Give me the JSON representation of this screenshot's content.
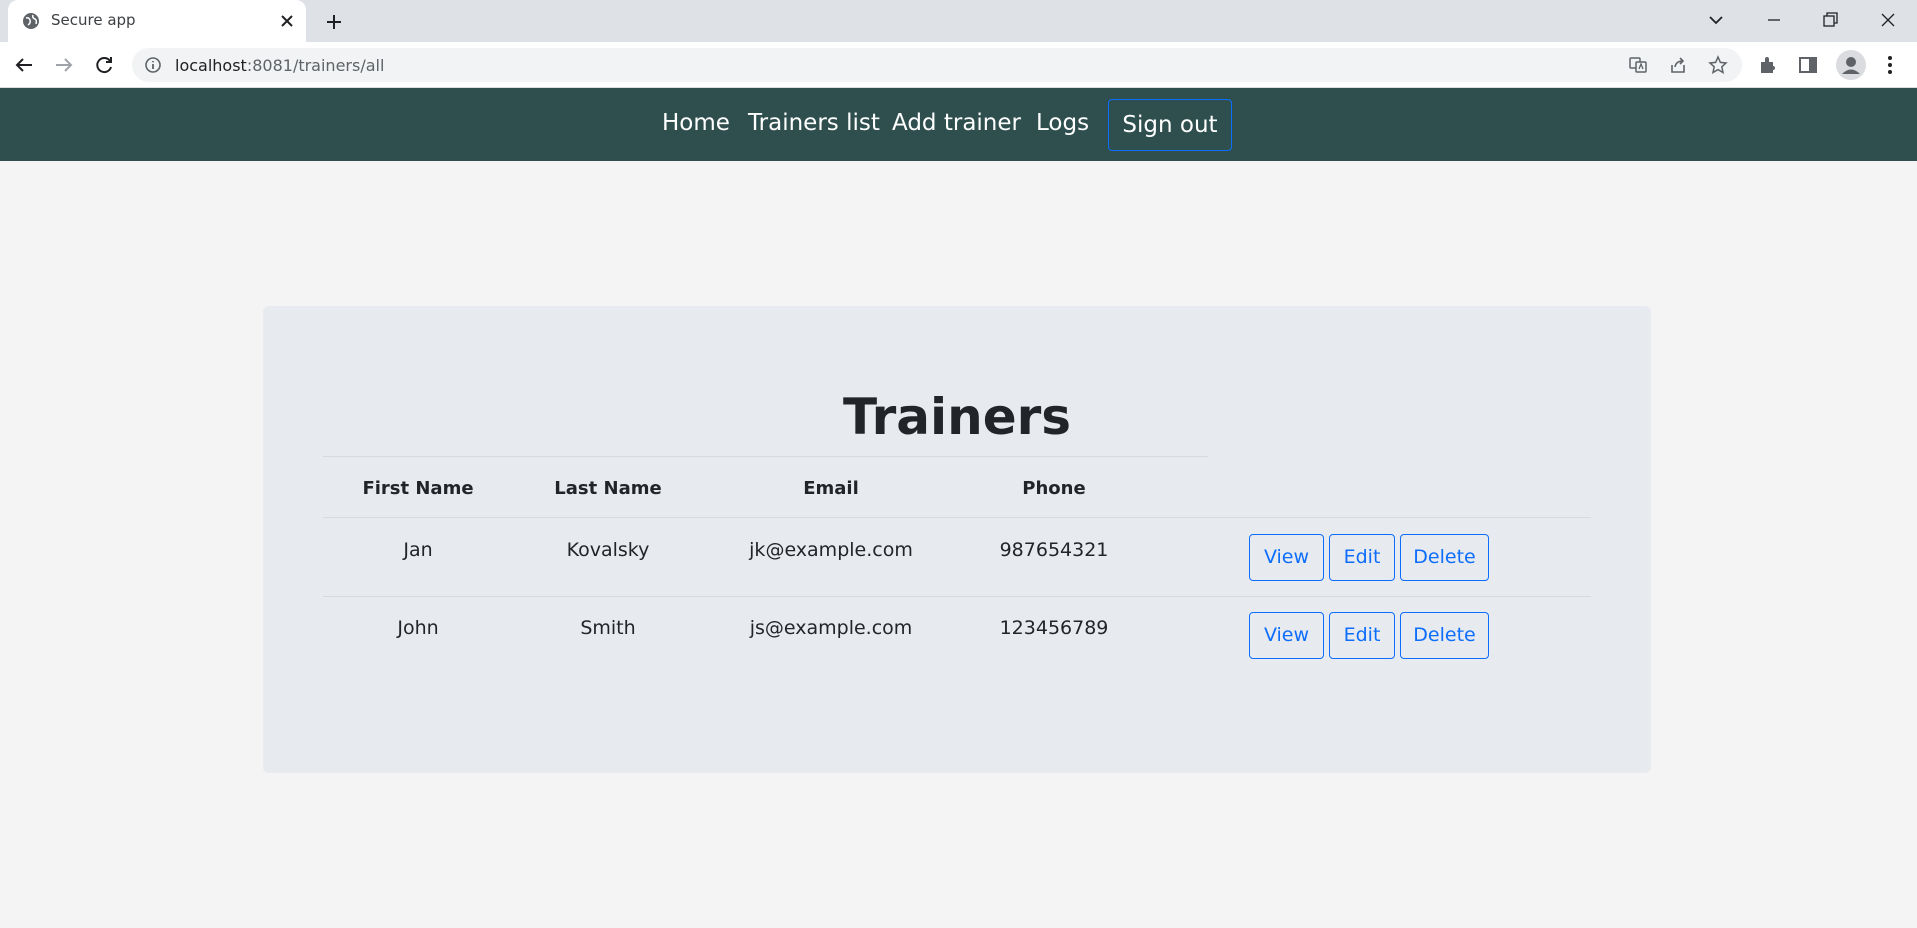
{
  "browser": {
    "tab_title": "Secure app",
    "url_host": "localhost",
    "url_rest": ":8081/trainers/all"
  },
  "nav": {
    "home": "Home",
    "trainers_list": "Trainers list",
    "add_trainer": "Add trainer",
    "logs": "Logs",
    "sign_out": "Sign out"
  },
  "page": {
    "title": "Trainers"
  },
  "table": {
    "headers": [
      "First Name",
      "Last Name",
      "Email",
      "Phone"
    ],
    "rows": [
      {
        "first_name": "Jan",
        "last_name": "Kovalsky",
        "email": "jk@example.com",
        "phone": "987654321"
      },
      {
        "first_name": "John",
        "last_name": "Smith",
        "email": "js@example.com",
        "phone": "123456789"
      }
    ],
    "actions": {
      "view": "View",
      "edit": "Edit",
      "delete": "Delete"
    }
  },
  "colors": {
    "navbar": "#2f4f4f",
    "accent": "#0d6efd",
    "card": "#e7eaee",
    "page_bg": "#f4f4f4"
  }
}
